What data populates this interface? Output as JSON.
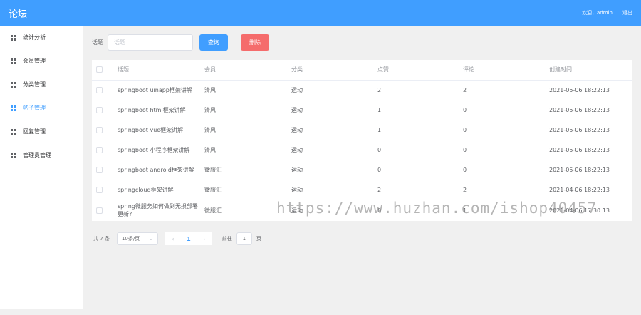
{
  "header": {
    "title": "论坛",
    "welcome": "欢迎，admin",
    "logout": "退出"
  },
  "sidebar": {
    "items": [
      {
        "label": "统计分析",
        "active": false
      },
      {
        "label": "会员管理",
        "active": false
      },
      {
        "label": "分类管理",
        "active": false
      },
      {
        "label": "帖子管理",
        "active": true
      },
      {
        "label": "回复管理",
        "active": false
      },
      {
        "label": "管理员管理",
        "active": false
      }
    ]
  },
  "search": {
    "label": "话题",
    "placeholder": "话题",
    "query_label": "查询",
    "delete_label": "删除"
  },
  "table": {
    "columns": [
      "话题",
      "会员",
      "分类",
      "点赞",
      "评论",
      "创建时间"
    ],
    "rows": [
      [
        "springboot uinapp框架讲解",
        "清风",
        "运动",
        "2",
        "2",
        "2021-05-06 18:22:13"
      ],
      [
        "springboot html框架讲解",
        "清风",
        "运动",
        "1",
        "0",
        "2021-05-06 18:22:13"
      ],
      [
        "springboot vue框架讲解",
        "清风",
        "运动",
        "1",
        "0",
        "2021-05-06 18:22:13"
      ],
      [
        "springboot 小程序框架讲解",
        "清风",
        "运动",
        "0",
        "0",
        "2021-05-06 18:22:13"
      ],
      [
        "springboot android框架讲解",
        "微服汇",
        "运动",
        "0",
        "0",
        "2021-05-06 18:22:13"
      ],
      [
        "springcloud框架讲解",
        "微服汇",
        "运动",
        "2",
        "2",
        "2021-04-06 18:22:13"
      ],
      [
        "spring微服务如何做到无损部署更新?",
        "微服汇",
        "运动",
        "0",
        "1",
        "2021-04-06 17:30:13"
      ]
    ]
  },
  "pagination": {
    "total": "共 7 条",
    "page_size": "10条/页",
    "prev": "‹",
    "current_page": "1",
    "next": "›",
    "goto_label": "前往",
    "goto_value": "1",
    "page_suffix": "页"
  },
  "watermark": "https://www.huzhan.com/ishop40457"
}
